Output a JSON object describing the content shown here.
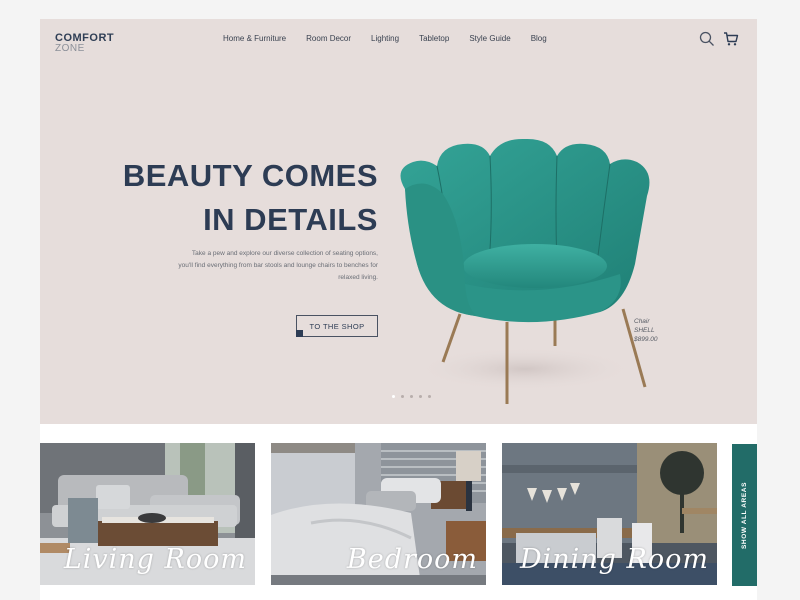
{
  "brand": {
    "line1": "COMFORT",
    "line2": "ZONE"
  },
  "nav": {
    "items": [
      {
        "label": "Home & Furniture"
      },
      {
        "label": "Room Decor"
      },
      {
        "label": "Lighting"
      },
      {
        "label": "Tabletop"
      },
      {
        "label": "Style Guide"
      },
      {
        "label": "Blog"
      }
    ]
  },
  "header_icons": {
    "search": "search-icon",
    "cart": "cart-icon"
  },
  "hero": {
    "headline_line1": "BEAUTY COMES",
    "headline_line2": "IN DETAILS",
    "description": "Take a pew and explore our diverse collection of seating options, you'll find everything from bar stools and lounge chairs to benches for relaxed living.",
    "cta_label": "TO THE SHOP",
    "product": {
      "type": "Chair",
      "name": "SHELL",
      "price": "$899.00"
    },
    "carousel": {
      "total": 5,
      "active": 1
    }
  },
  "areas": {
    "cards": [
      {
        "label": "Living Room"
      },
      {
        "label": "Bedroom"
      },
      {
        "label": "Dining Room"
      }
    ],
    "show_all_label": "SHOW ALL AREAS"
  },
  "colors": {
    "hero_bg": "#e6dddb",
    "navy": "#2d3c54",
    "teal_accent": "#226c68",
    "chair_teal": "#2a9a8e"
  }
}
